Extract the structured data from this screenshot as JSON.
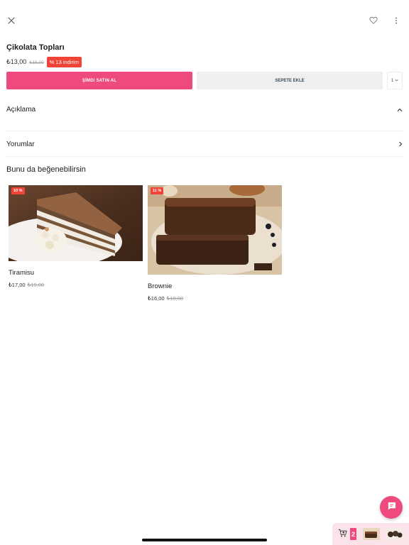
{
  "product": {
    "title": "Çikolata Topları",
    "price": "₺13,00",
    "old_price": "₺15,00",
    "discount": "% 13 indirim"
  },
  "actions": {
    "buy_now": "ŞİMDI SATIN AL",
    "add_to_cart": "SEPETE EKLE",
    "quantity": "1"
  },
  "sections": {
    "description": "Açıklama",
    "reviews": "Yorumlar"
  },
  "recommendations": {
    "title": "Bunu da beğenebilirsin",
    "items": [
      {
        "name": "Tiramisu",
        "price": "₺17,00",
        "old_price": "₺19,00",
        "badge": "10 %"
      },
      {
        "name": "Brownie",
        "price": "₺16,00",
        "old_price": "₺18,00",
        "badge": "11 %"
      }
    ]
  },
  "mini_cart": {
    "count": "2"
  },
  "icons": {
    "close": "close-icon",
    "favorite": "heart-icon",
    "more": "more-vertical-icon",
    "chevron_up": "chevron-up-icon",
    "chevron_right": "chevron-right-icon",
    "chat": "chat-icon",
    "cart": "cart-add-icon"
  },
  "colors": {
    "accent": "#ee4a7d",
    "discount": "#f04438",
    "secondary_button": "#efefef",
    "mini_cart_bg": "#fbe3ea"
  }
}
